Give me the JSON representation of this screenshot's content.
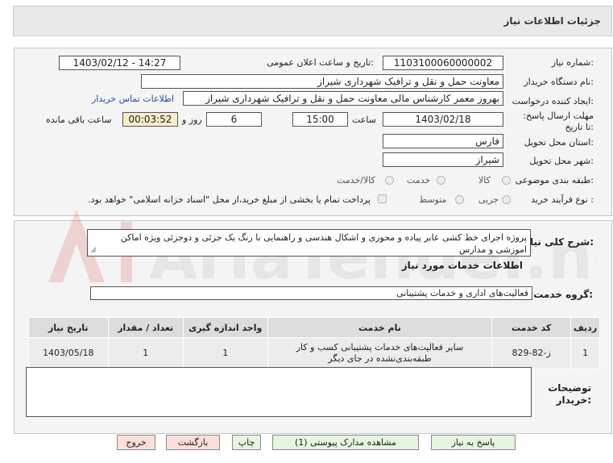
{
  "title": "جزئیات اطلاعات نیاز",
  "form": {
    "need_number_label": "شماره نیاز:",
    "need_number": "1103100060000002",
    "announce_label": "تاریخ و ساعت اعلان عمومی:",
    "announce_value": "1403/02/12 - 14:27",
    "buyer_org_label": "نام دستگاه خریدار:",
    "buyer_org": "معاونت حمل و نقل و ترافیک شهرداری شیراز",
    "creator_label": "ایجاد کننده درخواست:",
    "creator": "بهروز معمر کارشناس مالی معاونت حمل و نقل و ترافیک شهرداری شیراز",
    "contact_link": "اطلاعات تماس خریدار",
    "deadline_label": "مهلت ارسال پاسخ: تا تاریخ:",
    "deadline_date": "1403/02/18",
    "time_label": "ساعت",
    "deadline_time": "15:00",
    "days_value": "6",
    "days_label": "روز و",
    "remaining_time": "00:03:52",
    "remaining_label": "ساعت باقی مانده",
    "province_label": "استان محل تحویل:",
    "province": "فارس",
    "city_label": "شهر محل تحویل:",
    "city": "شیراز",
    "category_label": "طبقه بندی موضوعی:",
    "category_options": [
      "کالا",
      "خدمت",
      "کالا/خدمت"
    ],
    "process_label": "نوع فرآیند خرید :",
    "process_options": [
      "جزیی",
      "متوسط"
    ],
    "payment_note": "پرداخت تمام یا بخشی از مبلغ خرید،از محل \"اسناد خزانه اسلامی\" خواهد بود."
  },
  "description": {
    "label": "شرح کلی نیاز:",
    "text": "پروژه اجرای خط کشی عابر پیاده و محوری و اشکال هندسی و راهنمایی با رنگ یک جزئی و دوجزئی ویژه اماکن اموزشی و مدارس"
  },
  "services": {
    "section_title": "اطلاعات خدمات مورد نیاز",
    "group_label": "گروه خدمت:",
    "group_value": "فعالیت‌های اداری و خدمات پشتیبانی",
    "columns": [
      "ردیف",
      "کد خدمت",
      "نام خدمت",
      "واحد اندازه گیری",
      "تعداد / مقدار",
      "تاریخ نیاز"
    ],
    "rows": [
      {
        "index": "1",
        "code": "ز-82-829",
        "name_line1": "سایر فعالیت‌های خدمات پشتیبانی کسب و کار",
        "name_line2": "طبقه‌بندی‌نشده در جای دیگر",
        "unit": "1",
        "qty": "1",
        "date": "1403/05/18"
      }
    ]
  },
  "buyer_notes": {
    "label": "توضیحات خریدار:",
    "value": ""
  },
  "buttons": {
    "respond": "پاسخ به نیاز",
    "view_docs": "مشاهده مدارک پیوستی (1)",
    "print": "چاپ",
    "back": "بازگشت",
    "exit": "خروج"
  },
  "watermark_text": "AriaTender.net"
}
